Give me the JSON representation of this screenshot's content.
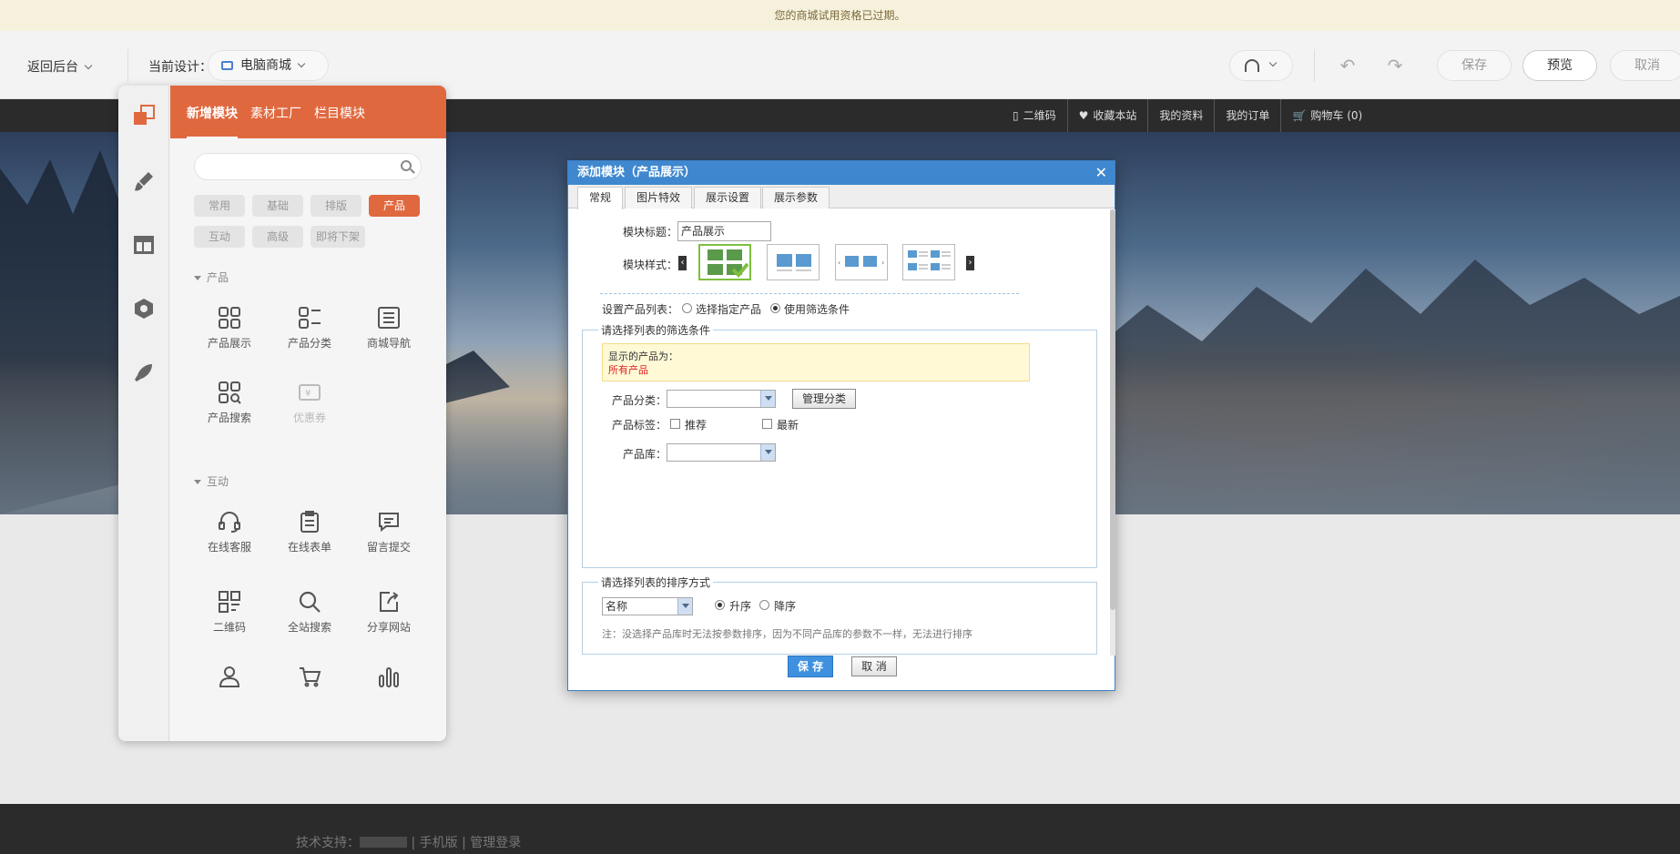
{
  "trial_notice": "您的商城试用资格已过期。",
  "topbar": {
    "back_label": "返回后台",
    "current_design_label": "当前设计：",
    "design_value": "电脑商城",
    "save_label": "保存",
    "preview_label": "预览",
    "cancel_label": "取消"
  },
  "site_nav": {
    "items": [
      "二维码",
      "收藏本站",
      "我的资料",
      "我的订单",
      "购物车 (0)"
    ]
  },
  "footer": {
    "support_label": "技术支持：",
    "mobile_label": "| 手机版",
    "admin_label": "| 管理登录"
  },
  "panel": {
    "tabs": [
      "新增模块",
      "素材工厂",
      "栏目模块"
    ],
    "close_glyph": "✕",
    "categories": [
      "常用",
      "基础",
      "排版",
      "产品",
      "互动",
      "高级",
      "即将下架"
    ],
    "active_category": "产品",
    "sections": [
      {
        "title": "产品",
        "items": [
          "产品展示",
          "产品分类",
          "商城导航",
          "产品搜索",
          "优惠券"
        ]
      },
      {
        "title": "互动",
        "items": [
          "在线客服",
          "在线表单",
          "留言提交",
          "二维码",
          "全站搜索",
          "分享网站"
        ]
      }
    ]
  },
  "dialog": {
    "title": "添加模块（产品展示）",
    "close_glyph": "✕",
    "tabs": [
      "常规",
      "图片特效",
      "展示设置",
      "展示参数"
    ],
    "module_title_label": "模块标题：",
    "module_title_value": "产品展示",
    "module_style_label": "模块样式：",
    "product_list_label": "设置产品列表：",
    "radio_select_products": "选择指定产品",
    "radio_use_filter": "使用筛选条件",
    "filter_legend": "请选择列表的筛选条件",
    "notice_line1": "显示的产品为：",
    "notice_line2": "所有产品",
    "category_label": "产品分类：",
    "manage_category_label": "管理分类",
    "tag_label": "产品标签：",
    "tag_recommend": "推荐",
    "tag_new": "最新",
    "library_label": "产品库：",
    "sort_legend": "请选择列表的排序方式",
    "sort_field_value": "名称",
    "sort_asc": "升序",
    "sort_desc": "降序",
    "note": "注：没选择产品库时无法按参数排序，因为不同产品库的参数不一样，无法进行排序",
    "save_label": "保 存",
    "cancel_label": "取 消"
  },
  "colors": {
    "accent": "#e0683f",
    "dialog_blue": "#3f88cf",
    "selected_style": "#7fbf3f"
  }
}
